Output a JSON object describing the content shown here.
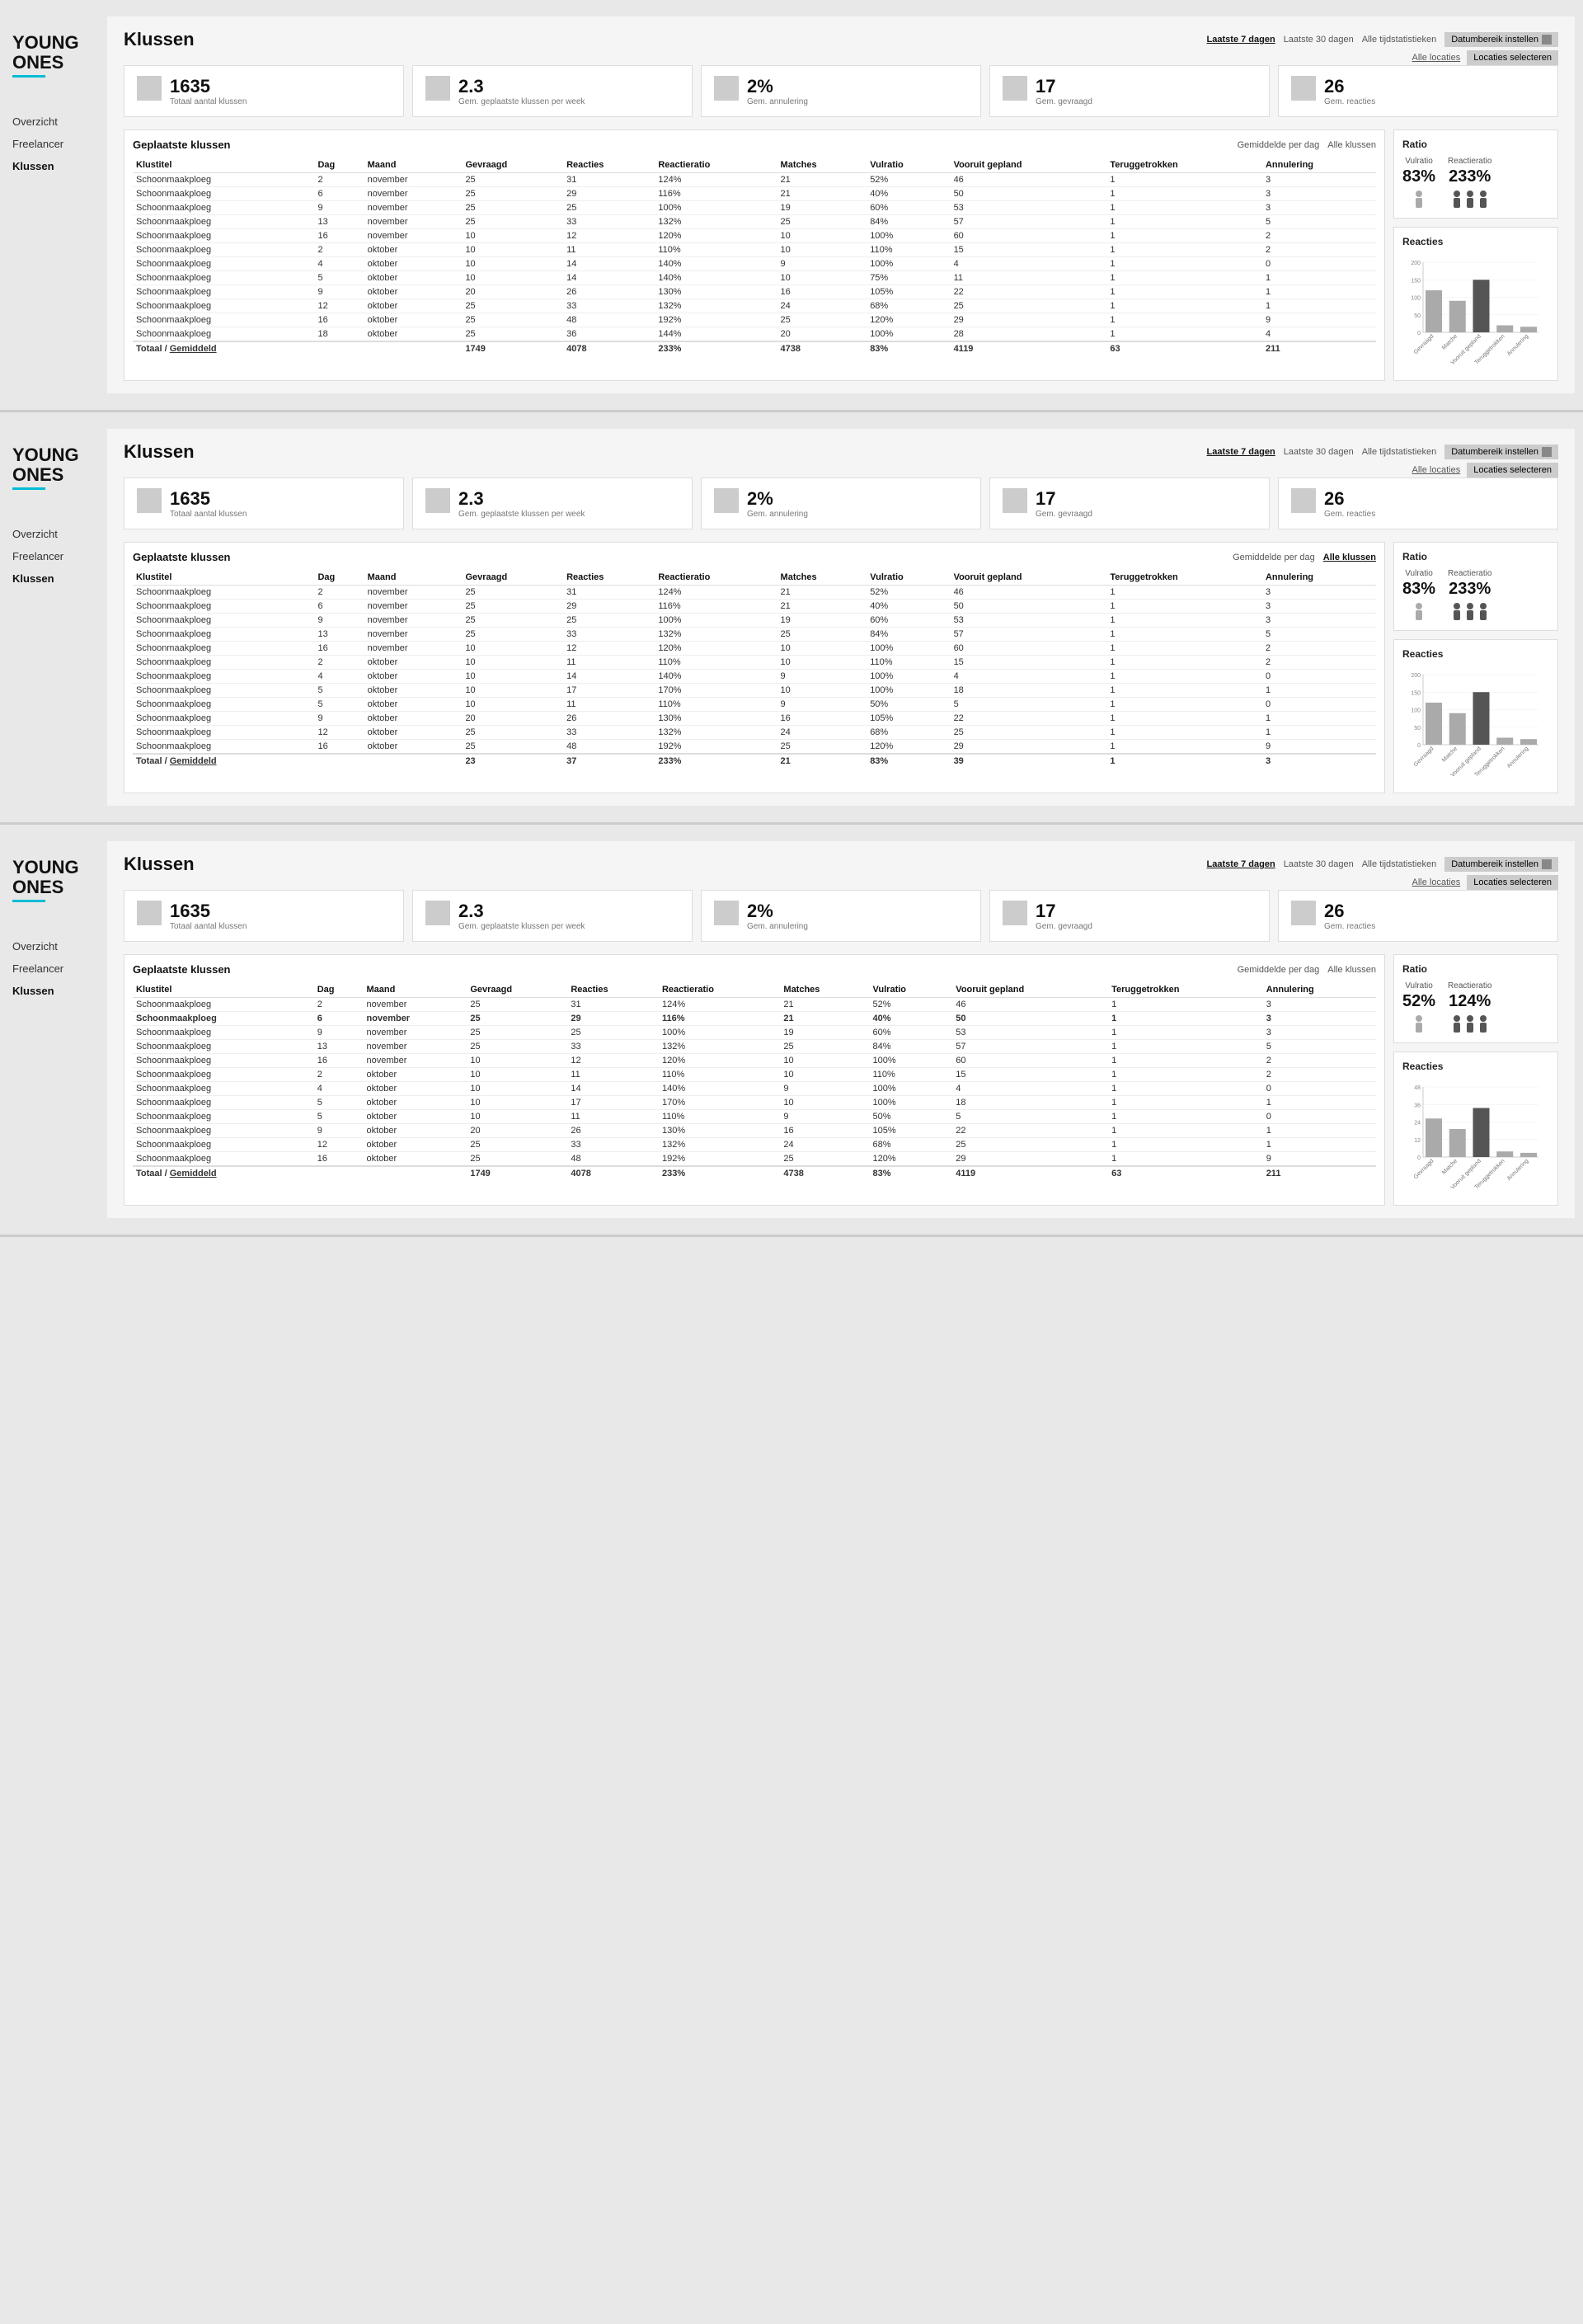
{
  "sections": [
    {
      "id": "section1",
      "sidebar": {
        "nav": [
          {
            "label": "Overzicht",
            "active": false
          },
          {
            "label": "Freelancer",
            "active": false
          },
          {
            "label": "Klussen",
            "active": true
          }
        ]
      },
      "header": {
        "title": "Klussen",
        "filters": [
          {
            "label": "Laatste 7 dagen",
            "active": true
          },
          {
            "label": "Laatste 30 dagen",
            "active": false
          },
          {
            "label": "Alle tijdstatistieken",
            "active": false
          }
        ],
        "dateRangeBtn": "Datumbereik instellen",
        "locationLabel": "Alle locaties",
        "locationBtn": "Locaties selecteren"
      },
      "stats": [
        {
          "number": "1635",
          "label": "Totaal aantal klussen"
        },
        {
          "number": "2.3",
          "label": "Gem. geplaatste klussen per week"
        },
        {
          "number": "2%",
          "label": "Gem. annulering"
        },
        {
          "number": "17",
          "label": "Gem. gevraagd"
        },
        {
          "number": "26",
          "label": "Gem. reacties"
        }
      ],
      "table": {
        "title": "Geplaatste klussen",
        "links": [
          {
            "label": "Gemiddelde per dag",
            "active": false
          },
          {
            "label": "Alle klussen",
            "active": false
          }
        ],
        "columns": [
          "Klustitel",
          "Dag",
          "Maand",
          "Gevraagd",
          "Reacties",
          "Reactieratio",
          "Matches",
          "Vulratio",
          "Vooruit gepland",
          "Teruggetrokken",
          "Annulering"
        ],
        "rows": [
          [
            "Schoonmaakploeg",
            "2",
            "november",
            "25",
            "31",
            "124%",
            "21",
            "52%",
            "46",
            "1",
            "3"
          ],
          [
            "Schoonmaakploeg",
            "6",
            "november",
            "25",
            "29",
            "116%",
            "21",
            "40%",
            "50",
            "1",
            "3"
          ],
          [
            "Schoonmaakploeg",
            "9",
            "november",
            "25",
            "25",
            "100%",
            "19",
            "60%",
            "53",
            "1",
            "3"
          ],
          [
            "Schoonmaakploeg",
            "13",
            "november",
            "25",
            "33",
            "132%",
            "25",
            "84%",
            "57",
            "1",
            "5"
          ],
          [
            "Schoonmaakploeg",
            "16",
            "november",
            "10",
            "12",
            "120%",
            "10",
            "100%",
            "60",
            "1",
            "2"
          ],
          [
            "Schoonmaakploeg",
            "2",
            "oktober",
            "10",
            "11",
            "110%",
            "10",
            "110%",
            "15",
            "1",
            "2"
          ],
          [
            "Schoonmaakploeg",
            "4",
            "oktober",
            "10",
            "14",
            "140%",
            "9",
            "100%",
            "4",
            "1",
            "0"
          ],
          [
            "Schoonmaakploeg",
            "5",
            "oktober",
            "10",
            "14",
            "140%",
            "10",
            "75%",
            "11",
            "1",
            "1"
          ],
          [
            "Schoonmaakploeg",
            "9",
            "oktober",
            "20",
            "26",
            "130%",
            "16",
            "105%",
            "22",
            "1",
            "1"
          ],
          [
            "Schoonmaakploeg",
            "12",
            "oktober",
            "25",
            "33",
            "132%",
            "24",
            "68%",
            "25",
            "1",
            "1"
          ],
          [
            "Schoonmaakploeg",
            "16",
            "oktober",
            "25",
            "48",
            "192%",
            "25",
            "120%",
            "29",
            "1",
            "9"
          ],
          [
            "Schoonmaakploeg",
            "18",
            "oktober",
            "25",
            "36",
            "144%",
            "20",
            "100%",
            "28",
            "1",
            "4"
          ]
        ],
        "totalRow": [
          "Totaal / Gemiddeld",
          "",
          "",
          "1749",
          "4078",
          "233%",
          "4738",
          "83%",
          "4119",
          "63",
          "211"
        ],
        "highlightedRow": null
      },
      "ratio": {
        "title": "Ratio",
        "vulratio": {
          "label": "Vulratio",
          "value": "83%"
        },
        "reactieratio": {
          "label": "Reactieratio",
          "value": "233%"
        }
      },
      "chart": {
        "title": "Reacties",
        "yLabels": [
          "200",
          "150",
          "100",
          "50",
          "0"
        ],
        "bars": [
          {
            "label": "Gevraagd",
            "height": 60,
            "dark": false
          },
          {
            "label": "Matche",
            "height": 45,
            "dark": false
          },
          {
            "label": "Vooruit gepland",
            "height": 75,
            "dark": true
          },
          {
            "label": "Teruggetrokken",
            "height": 10,
            "dark": false
          },
          {
            "label": "Annulering",
            "height": 8,
            "dark": false
          }
        ]
      }
    },
    {
      "id": "section2",
      "sidebar": {
        "nav": [
          {
            "label": "Overzicht",
            "active": false
          },
          {
            "label": "Freelancer",
            "active": false
          },
          {
            "label": "Klussen",
            "active": true
          }
        ]
      },
      "header": {
        "title": "Klussen",
        "filters": [
          {
            "label": "Laatste 7 dagen",
            "active": true
          },
          {
            "label": "Laatste 30 dagen",
            "active": false
          },
          {
            "label": "Alle tijdstatistieken",
            "active": false
          }
        ],
        "dateRangeBtn": "Datumbereik instellen",
        "locationLabel": "Alle locaties",
        "locationBtn": "Locaties selecteren"
      },
      "stats": [
        {
          "number": "1635",
          "label": "Totaal aantal klussen"
        },
        {
          "number": "2.3",
          "label": "Gem. geplaatste klussen per week"
        },
        {
          "number": "2%",
          "label": "Gem. annulering"
        },
        {
          "number": "17",
          "label": "Gem. gevraagd"
        },
        {
          "number": "26",
          "label": "Gem. reacties"
        }
      ],
      "table": {
        "title": "Geplaatste klussen",
        "links": [
          {
            "label": "Gemiddelde per dag",
            "active": false
          },
          {
            "label": "Alle klussen",
            "active": true
          }
        ],
        "columns": [
          "Klustitel",
          "Dag",
          "Maand",
          "Gevraagd",
          "Reacties",
          "Reactieratio",
          "Matches",
          "Vulratio",
          "Vooruit gepland",
          "Teruggetrokken",
          "Annulering"
        ],
        "rows": [
          [
            "Schoonmaakploeg",
            "2",
            "november",
            "25",
            "31",
            "124%",
            "21",
            "52%",
            "46",
            "1",
            "3"
          ],
          [
            "Schoonmaakploeg",
            "6",
            "november",
            "25",
            "29",
            "116%",
            "21",
            "40%",
            "50",
            "1",
            "3"
          ],
          [
            "Schoonmaakploeg",
            "9",
            "november",
            "25",
            "25",
            "100%",
            "19",
            "60%",
            "53",
            "1",
            "3"
          ],
          [
            "Schoonmaakploeg",
            "13",
            "november",
            "25",
            "33",
            "132%",
            "25",
            "84%",
            "57",
            "1",
            "5"
          ],
          [
            "Schoonmaakploeg",
            "16",
            "november",
            "10",
            "12",
            "120%",
            "10",
            "100%",
            "60",
            "1",
            "2"
          ],
          [
            "Schoonmaakploeg",
            "2",
            "oktober",
            "10",
            "11",
            "110%",
            "10",
            "110%",
            "15",
            "1",
            "2"
          ],
          [
            "Schoonmaakploeg",
            "4",
            "oktober",
            "10",
            "14",
            "140%",
            "9",
            "100%",
            "4",
            "1",
            "0"
          ],
          [
            "Schoonmaakploeg",
            "5",
            "oktober",
            "10",
            "17",
            "170%",
            "10",
            "100%",
            "18",
            "1",
            "1"
          ],
          [
            "Schoonmaakploeg",
            "5",
            "oktober",
            "10",
            "11",
            "110%",
            "9",
            "50%",
            "5",
            "1",
            "0"
          ],
          [
            "Schoonmaakploeg",
            "9",
            "oktober",
            "20",
            "26",
            "130%",
            "16",
            "105%",
            "22",
            "1",
            "1"
          ],
          [
            "Schoonmaakploeg",
            "12",
            "oktober",
            "25",
            "33",
            "132%",
            "24",
            "68%",
            "25",
            "1",
            "1"
          ],
          [
            "Schoonmaakploeg",
            "16",
            "oktober",
            "25",
            "48",
            "192%",
            "25",
            "120%",
            "29",
            "1",
            "9"
          ]
        ],
        "totalRow": [
          "Totaal / Gemiddeld",
          "",
          "",
          "23",
          "37",
          "233%",
          "21",
          "83%",
          "39",
          "1",
          "3"
        ],
        "highlightedRow": null
      },
      "ratio": {
        "title": "Ratio",
        "vulratio": {
          "label": "Vulratio",
          "value": "83%"
        },
        "reactieratio": {
          "label": "Reactieratio",
          "value": "233%"
        }
      },
      "chart": {
        "title": "Reacties",
        "yLabels": [
          "200",
          "150",
          "100",
          "50",
          "0"
        ],
        "bars": [
          {
            "label": "Gevraagd",
            "height": 60,
            "dark": false
          },
          {
            "label": "Matche",
            "height": 45,
            "dark": false
          },
          {
            "label": "Vooruit gepland",
            "height": 75,
            "dark": true
          },
          {
            "label": "Teruggetrokken",
            "height": 10,
            "dark": false
          },
          {
            "label": "Annulering",
            "height": 8,
            "dark": false
          }
        ]
      }
    },
    {
      "id": "section3",
      "sidebar": {
        "nav": [
          {
            "label": "Overzicht",
            "active": false
          },
          {
            "label": "Freelancer",
            "active": false
          },
          {
            "label": "Klussen",
            "active": true
          }
        ]
      },
      "header": {
        "title": "Klussen",
        "filters": [
          {
            "label": "Laatste 7 dagen",
            "active": true
          },
          {
            "label": "Laatste 30 dagen",
            "active": false
          },
          {
            "label": "Alle tijdstatistieken",
            "active": false
          }
        ],
        "dateRangeBtn": "Datumbereik instellen",
        "locationLabel": "Alle locaties",
        "locationBtn": "Locaties selecteren"
      },
      "stats": [
        {
          "number": "1635",
          "label": "Totaal aantal klussen"
        },
        {
          "number": "2.3",
          "label": "Gem. geplaatste klussen per week"
        },
        {
          "number": "2%",
          "label": "Gem. annulering"
        },
        {
          "number": "17",
          "label": "Gem. gevraagd"
        },
        {
          "number": "26",
          "label": "Gem. reacties"
        }
      ],
      "table": {
        "title": "Geplaatste klussen",
        "links": [
          {
            "label": "Gemiddelde per dag",
            "active": false
          },
          {
            "label": "Alle klussen",
            "active": false
          }
        ],
        "columns": [
          "Klustitel",
          "Dag",
          "Maand",
          "Gevraagd",
          "Reacties",
          "Reactieratio",
          "Matches",
          "Vulratio",
          "Vooruit gepland",
          "Teruggetrokken",
          "Annulering"
        ],
        "rows": [
          [
            "Schoonmaakploeg",
            "2",
            "november",
            "25",
            "31",
            "124%",
            "21",
            "52%",
            "46",
            "1",
            "3"
          ],
          [
            "Schoonmaakploeg",
            "6",
            "november",
            "25",
            "29",
            "116%",
            "21",
            "40%",
            "50",
            "1",
            "3"
          ],
          [
            "Schoonmaakploeg",
            "9",
            "november",
            "25",
            "25",
            "100%",
            "19",
            "60%",
            "53",
            "1",
            "3"
          ],
          [
            "Schoonmaakploeg",
            "13",
            "november",
            "25",
            "33",
            "132%",
            "25",
            "84%",
            "57",
            "1",
            "5"
          ],
          [
            "Schoonmaakploeg",
            "16",
            "november",
            "10",
            "12",
            "120%",
            "10",
            "100%",
            "60",
            "1",
            "2"
          ],
          [
            "Schoonmaakploeg",
            "2",
            "oktober",
            "10",
            "11",
            "110%",
            "10",
            "110%",
            "15",
            "1",
            "2"
          ],
          [
            "Schoonmaakploeg",
            "4",
            "oktober",
            "10",
            "14",
            "140%",
            "9",
            "100%",
            "4",
            "1",
            "0"
          ],
          [
            "Schoonmaakploeg",
            "5",
            "oktober",
            "10",
            "17",
            "170%",
            "10",
            "100%",
            "18",
            "1",
            "1"
          ],
          [
            "Schoonmaakploeg",
            "5",
            "oktober",
            "10",
            "11",
            "110%",
            "9",
            "50%",
            "5",
            "1",
            "0"
          ],
          [
            "Schoonmaakploeg",
            "9",
            "oktober",
            "20",
            "26",
            "130%",
            "16",
            "105%",
            "22",
            "1",
            "1"
          ],
          [
            "Schoonmaakploeg",
            "12",
            "oktober",
            "25",
            "33",
            "132%",
            "24",
            "68%",
            "25",
            "1",
            "1"
          ],
          [
            "Schoonmaakploeg",
            "16",
            "oktober",
            "25",
            "48",
            "192%",
            "25",
            "120%",
            "29",
            "1",
            "9"
          ]
        ],
        "totalRow": [
          "Totaal / Gemiddeld",
          "",
          "",
          "1749",
          "4078",
          "233%",
          "4738",
          "83%",
          "4119",
          "63",
          "211"
        ],
        "highlightedRow": 1
      },
      "ratio": {
        "title": "Ratio",
        "vulratio": {
          "label": "Vulratio",
          "value": "52%"
        },
        "reactieratio": {
          "label": "Reactieratio",
          "value": "124%"
        }
      },
      "chart": {
        "title": "Reacties",
        "yLabels": [
          "48",
          "36",
          "24",
          "12",
          "0"
        ],
        "bars": [
          {
            "label": "Gevraagd",
            "height": 55,
            "dark": false
          },
          {
            "label": "Matche",
            "height": 40,
            "dark": false
          },
          {
            "label": "Vooruit gepland",
            "height": 70,
            "dark": true
          },
          {
            "label": "Teruggetrokken",
            "height": 8,
            "dark": false
          },
          {
            "label": "Annulering",
            "height": 6,
            "dark": false
          }
        ]
      }
    }
  ],
  "logo": {
    "line1": "YOUNG",
    "line2": "ONES"
  }
}
